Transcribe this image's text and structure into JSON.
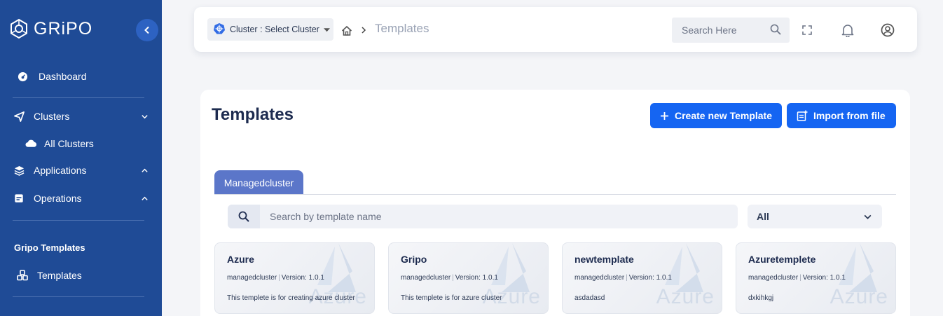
{
  "brand": {
    "name": "GRiPO"
  },
  "sidebar": {
    "items": [
      {
        "label": "Dashboard",
        "icon": "dashboard-icon"
      },
      {
        "label": "Clusters",
        "icon": "send-icon",
        "expanded": true
      },
      {
        "label": "All Clusters",
        "icon": "cloud-icon"
      },
      {
        "label": "Applications",
        "icon": "layers-icon",
        "expanded": false
      },
      {
        "label": "Operations",
        "icon": "calendar-icon",
        "expanded": false
      },
      {
        "label": "Templates",
        "icon": "cubes-icon"
      }
    ],
    "section_title": "Gripo Templates"
  },
  "topbar": {
    "cluster_select": "Cluster : Select Cluster",
    "breadcrumb_current": "Templates",
    "search_placeholder": "Search Here"
  },
  "main": {
    "title": "Templates",
    "create_button": "Create new Template",
    "import_button": "Import from file",
    "tab": "Managedcluster",
    "search_placeholder": "Search by template name",
    "filter_value": "All",
    "cards": [
      {
        "name": "Azure",
        "type": "managedcluster",
        "version": "Version: 1.0.1",
        "description": "This templete is for creating azure cluster",
        "watermark": "Azure"
      },
      {
        "name": "Gripo",
        "type": "managedcluster",
        "version": "Version: 1.0.1",
        "description": "This templete is for azure cluster",
        "watermark": "Azure"
      },
      {
        "name": "newtemplate",
        "type": "managedcluster",
        "version": "Version: 1.0.1",
        "description": "asdadasd",
        "watermark": "Azure"
      },
      {
        "name": "Azuretemplete",
        "type": "managedcluster",
        "version": "Version: 1.0.1",
        "description": "dxkihkgj",
        "watermark": "Azure"
      }
    ]
  },
  "colors": {
    "sidebar": "#1f4b96",
    "primary": "#1565f2",
    "tab": "#5b76c9"
  }
}
